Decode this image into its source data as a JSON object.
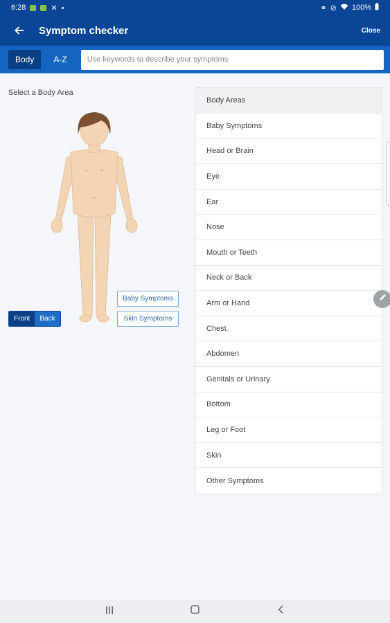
{
  "status_bar": {
    "time": "6:28",
    "battery": "100%"
  },
  "app_bar": {
    "title": "Symptom checker",
    "close_label": "Close"
  },
  "search_row": {
    "tabs": [
      {
        "label": "Body",
        "active": true
      },
      {
        "label": "A-Z",
        "active": false
      }
    ],
    "search_placeholder": "Use keywords to describe your symptoms"
  },
  "body_panel": {
    "select_label": "Select a Body Area",
    "view_toggle": {
      "front_label": "Front",
      "back_label": "Back",
      "selected": "Front"
    },
    "baby_symptoms_label": "Baby Symptoms",
    "skin_symptoms_label": "Skin Symptoms"
  },
  "body_areas": {
    "header": "Body Areas",
    "items": [
      "Baby Symptoms",
      "Head or Brain",
      "Eye",
      "Ear",
      "Nose",
      "Mouth or Teeth",
      "Neck or Back",
      "Arm or Hand",
      "Chest",
      "Abdomen",
      "Genitals or Urinary",
      "Bottom",
      "Leg or Foot",
      "Skin",
      "Other Symptoms"
    ]
  },
  "icons": {
    "back": "arrow-left-icon",
    "edit": "pencil-icon",
    "nav": [
      "recents-icon",
      "home-icon",
      "nav-back-icon"
    ]
  },
  "colors": {
    "brand": "#0a4596",
    "search_bar": "#1565c0",
    "link": "#2d6ab0",
    "skin": "#f3d4b4",
    "hair": "#7a5030"
  }
}
